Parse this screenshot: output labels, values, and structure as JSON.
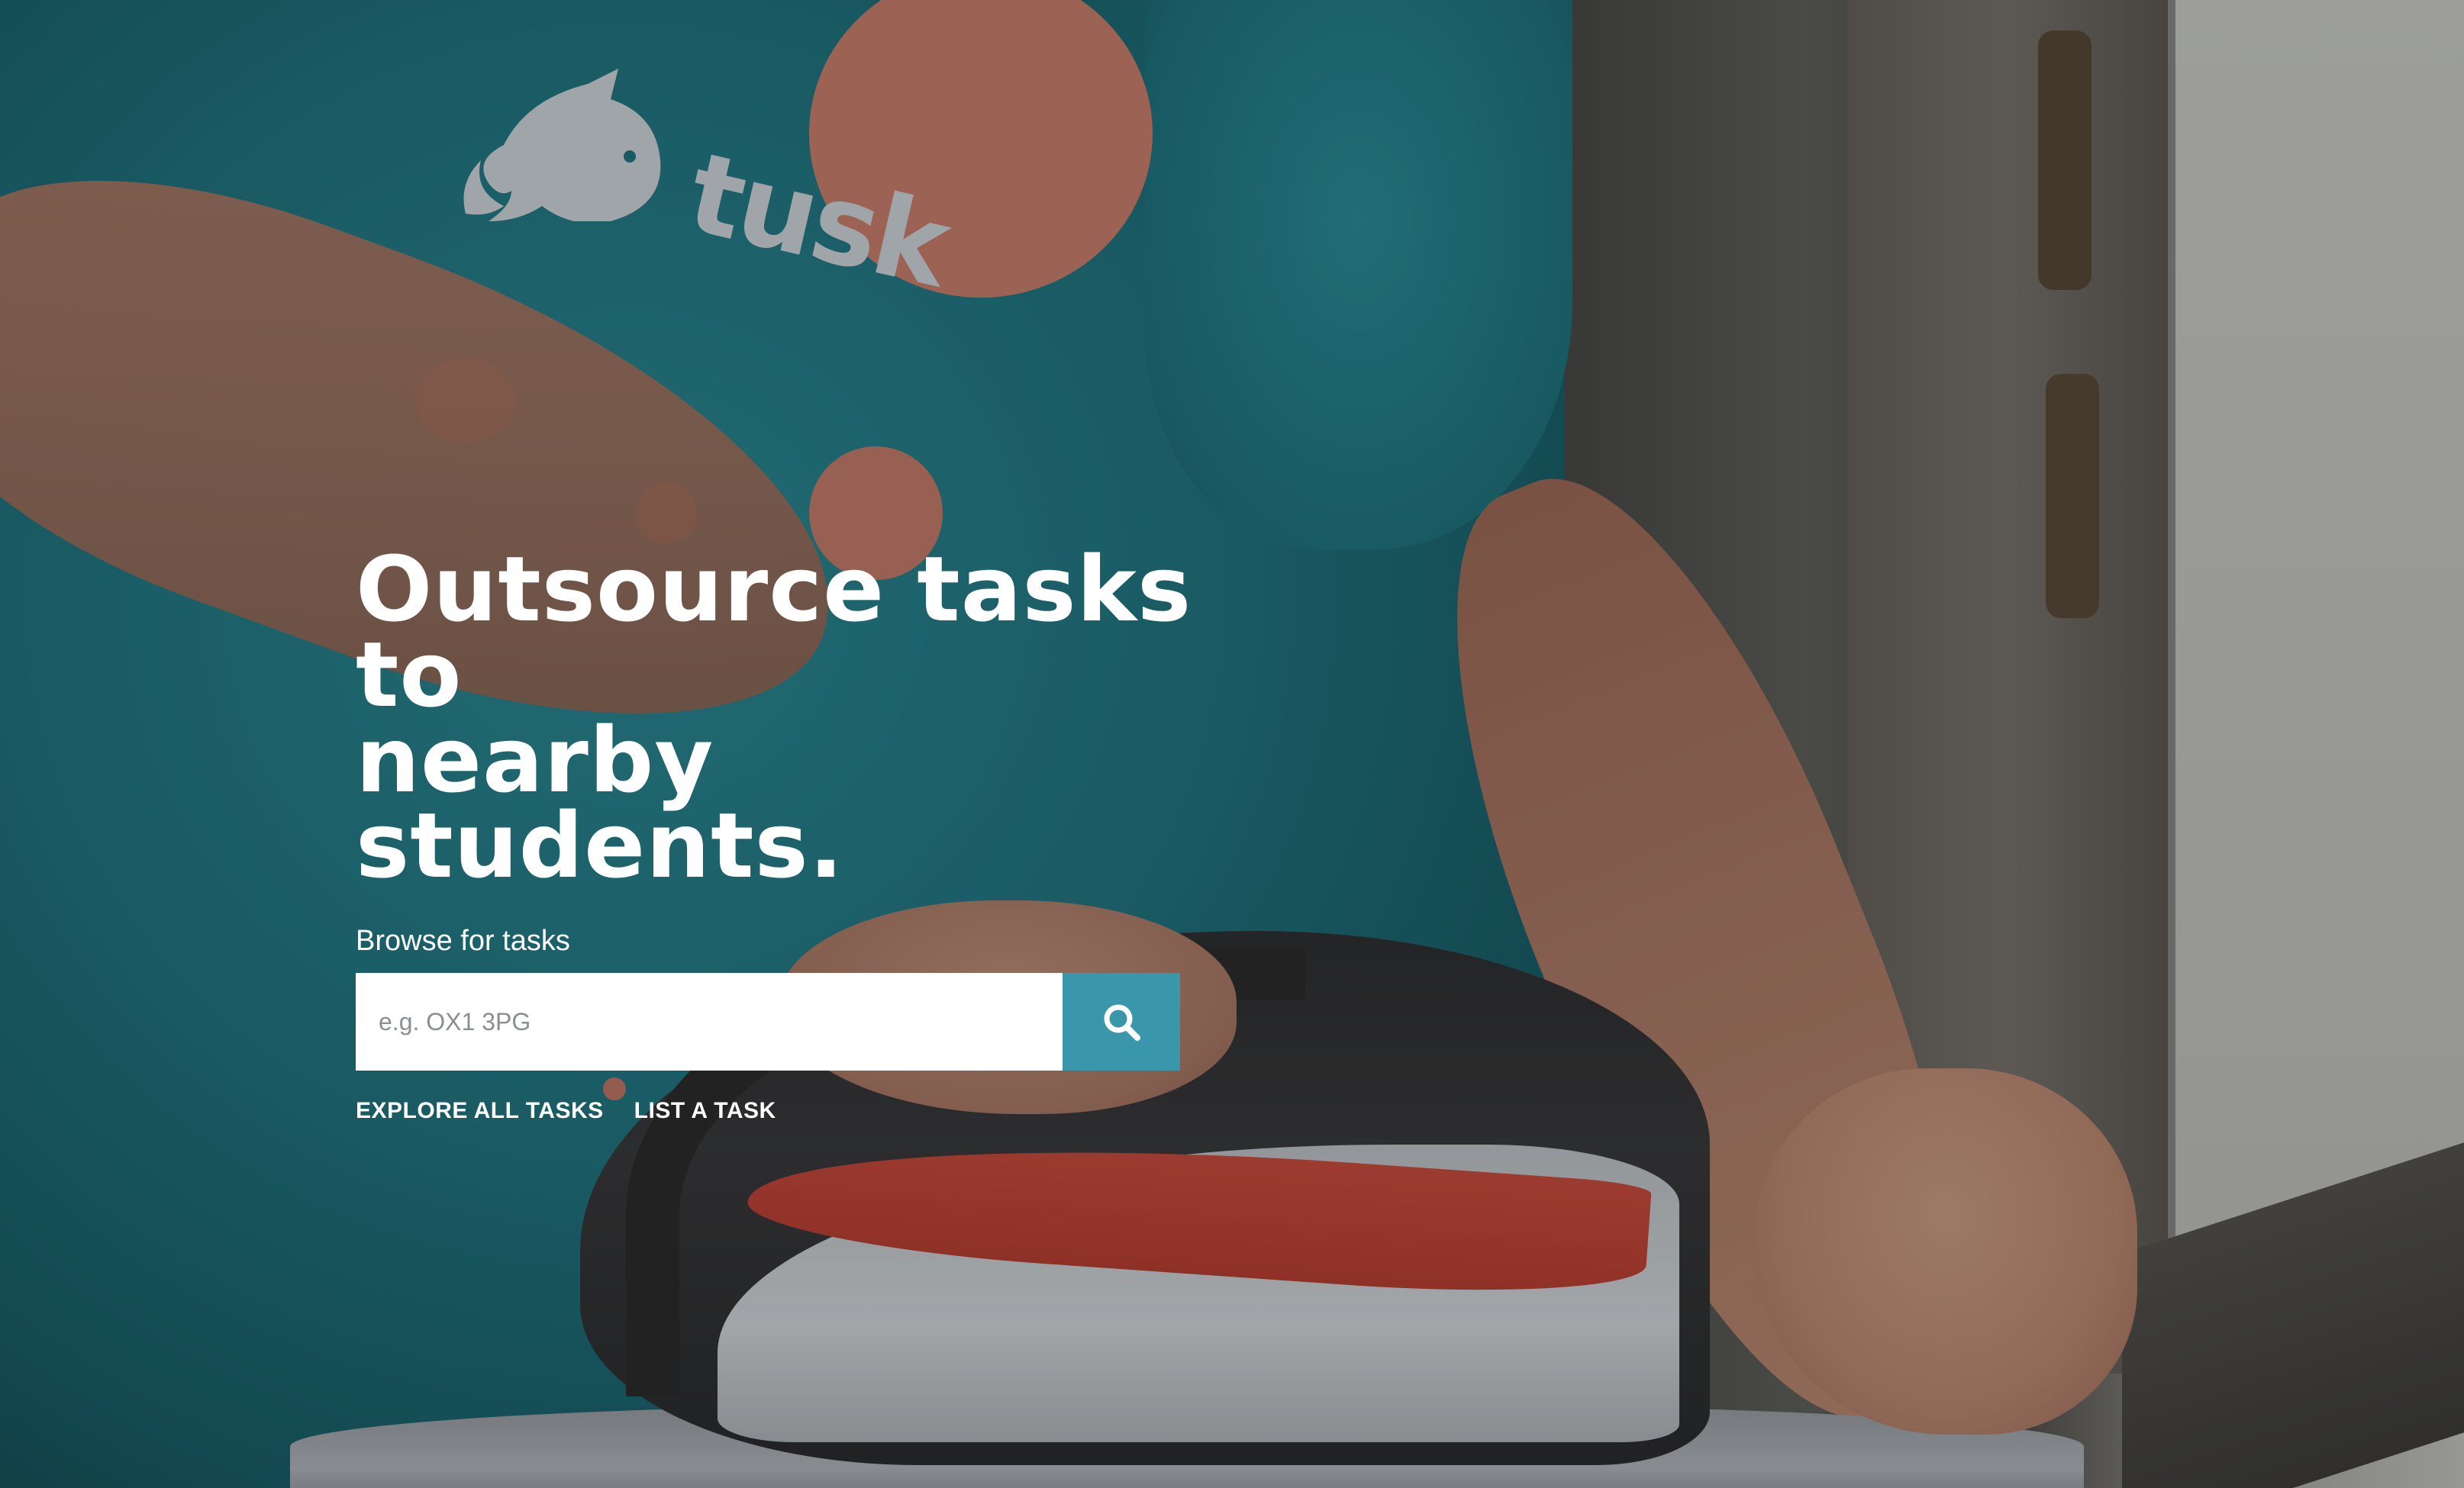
{
  "brand": {
    "logo_text": "tusk",
    "accent_color": "#3a97ab"
  },
  "hero": {
    "headline_line1": "Outsource tasks to",
    "headline_line2": "nearby students.",
    "browse_label": "Browse for tasks",
    "search": {
      "placeholder": "e.g. OX1 3PG",
      "value": "",
      "button_icon": "search-icon"
    },
    "links": {
      "explore": "EXPLORE ALL TASKS",
      "list": "LIST A TASK"
    }
  }
}
